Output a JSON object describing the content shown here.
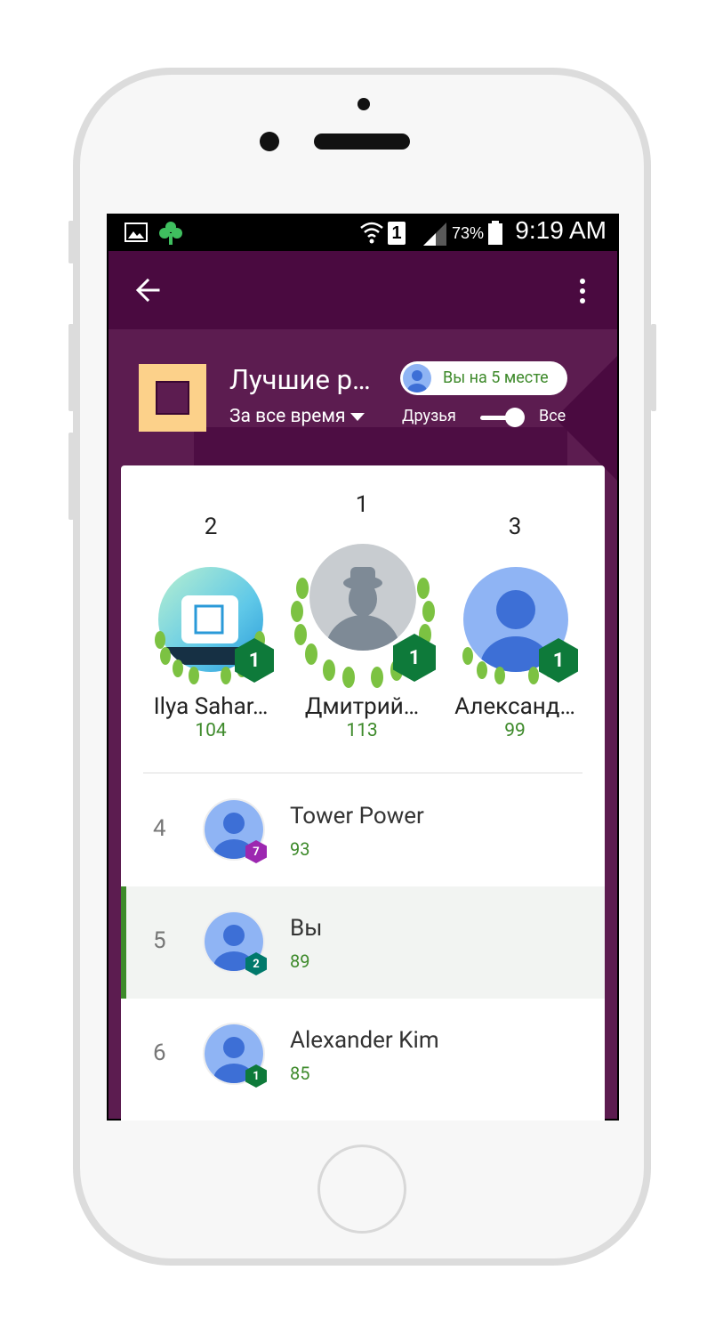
{
  "status_bar": {
    "battery": "73%",
    "time": "9:19 AM",
    "sim_slot": "1"
  },
  "colors": {
    "appbar": "#4a0a40",
    "hero": "#5c1c50",
    "score_green": "#3e8a2b",
    "level_green": "#0e7a3a",
    "level_purple": "#9c27b0",
    "level_teal": "#00796b"
  },
  "header": {
    "title": "Лучшие р…",
    "period": "За все время",
    "my_rank": "Вы на 5 месте",
    "toggle_left": "Друзья",
    "toggle_right": "Все"
  },
  "podium": [
    {
      "place": "2",
      "name": "Ilya Sahar…",
      "score": "104",
      "level": "1"
    },
    {
      "place": "1",
      "name": "Дмитрий…",
      "score": "113",
      "level": "1"
    },
    {
      "place": "3",
      "name": "Александ…",
      "score": "99",
      "level": "1"
    }
  ],
  "rows": [
    {
      "rank": "4",
      "name": "Tower Power",
      "score": "93",
      "level": "7"
    },
    {
      "rank": "5",
      "name": "Вы",
      "score": "89",
      "level": "2"
    },
    {
      "rank": "6",
      "name": "Alexander Kim",
      "score": "85",
      "level": "1"
    }
  ]
}
